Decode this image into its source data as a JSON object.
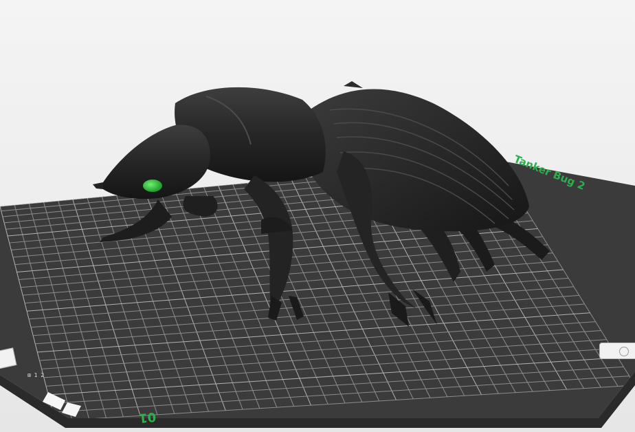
{
  "scene": {
    "plate_label_top": "Tanker Bug 2",
    "plate_label_bottom": "01",
    "plate_small_mark": "⊞ 1 2"
  },
  "colors": {
    "background": "#eeeeee",
    "plate": "#3a3a3a",
    "grid_line": "#8a8a8a",
    "model": "#262626",
    "eye": "#35c23a",
    "label": "#2fae4f"
  }
}
